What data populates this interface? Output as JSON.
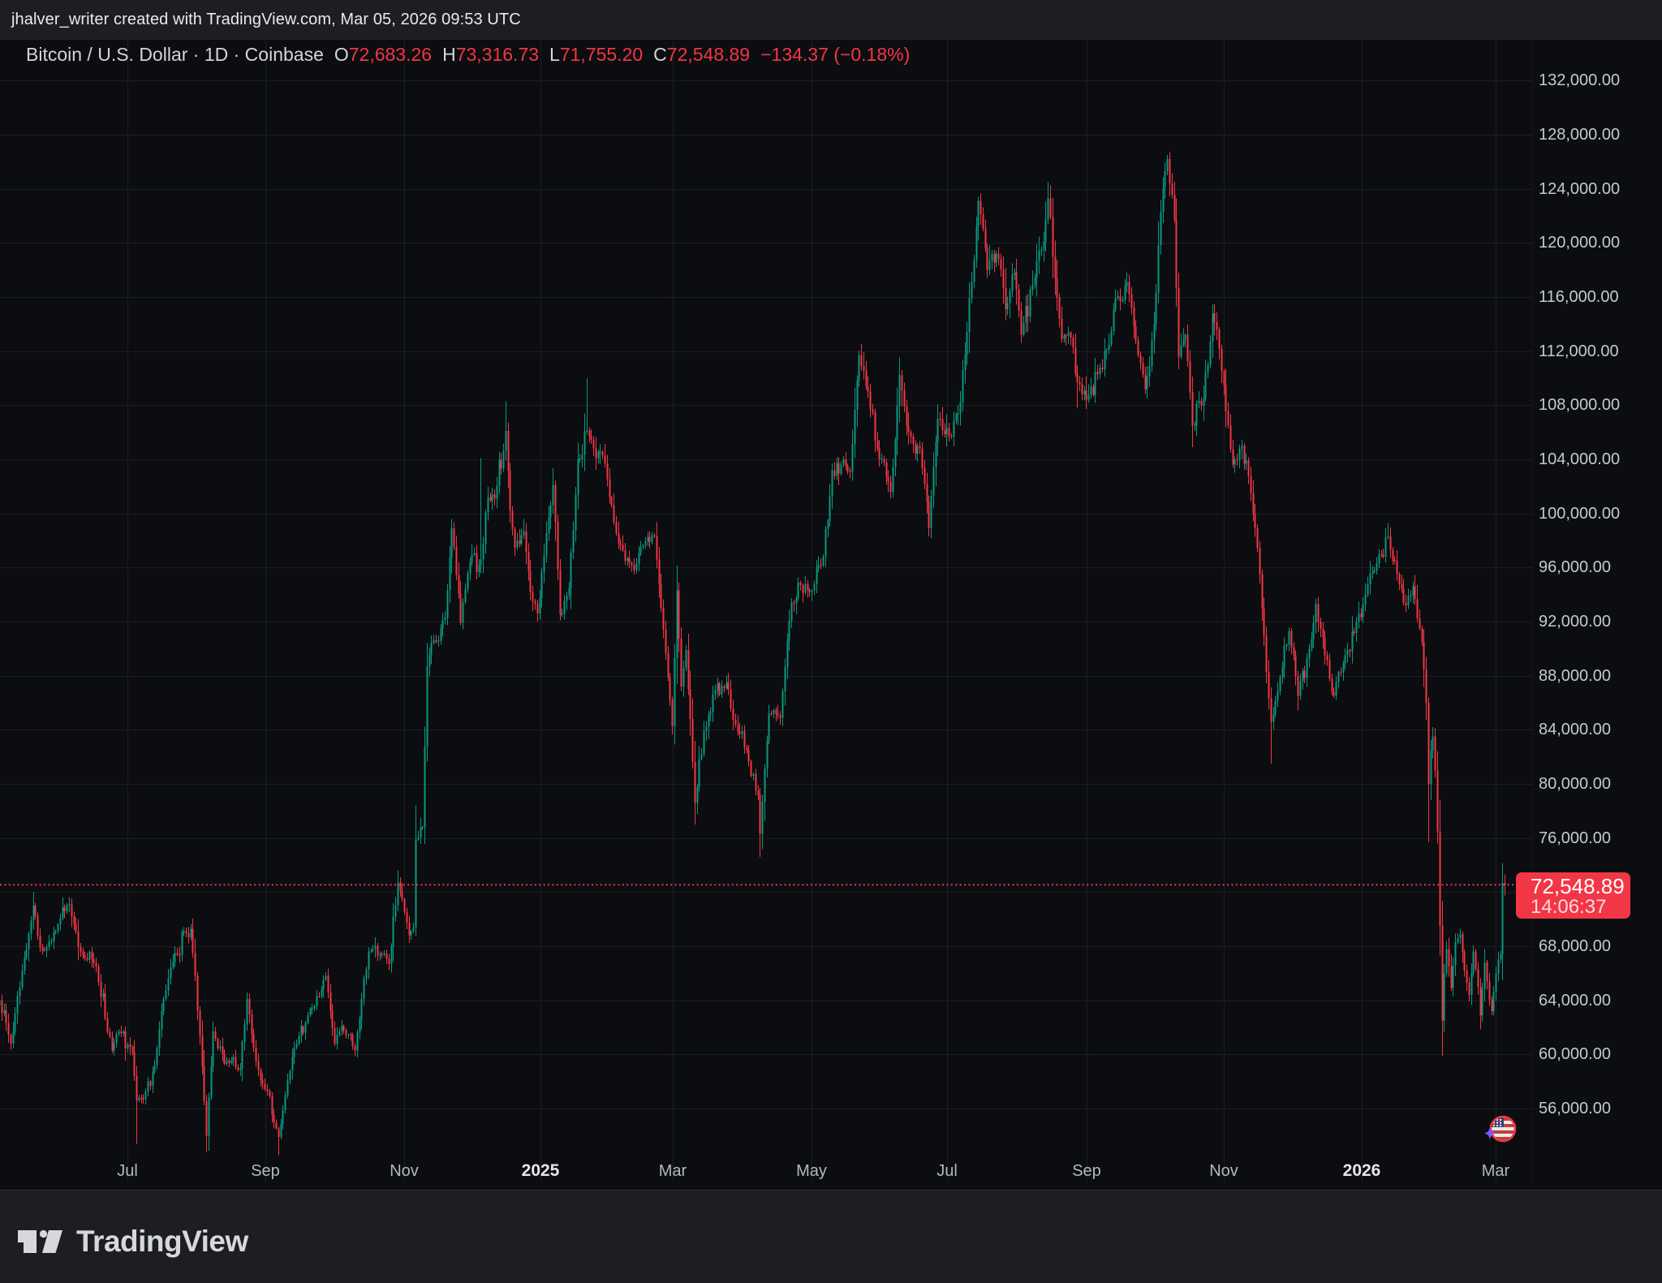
{
  "attribution_bar": {
    "text": "jhalver_writer created with TradingView.com, Mar 05, 2026 09:53 UTC"
  },
  "legend": {
    "title": "Bitcoin / U.S. Dollar · 1D · Coinbase",
    "o_label": "O",
    "o": "72,683.26",
    "h_label": "H",
    "h": "73,316.73",
    "l_label": "L",
    "l": "71,755.20",
    "c_label": "C",
    "c": "72,548.89",
    "change": "−134.37 (−0.18%)"
  },
  "price_tag": {
    "price": "72,548.89",
    "countdown": "14:06:37",
    "value": 72548.89
  },
  "logo": {
    "text": "TradingView"
  },
  "colors": {
    "up": "#089981",
    "down": "#f23645",
    "accent": "#f23645",
    "bg": "#0c0d10",
    "panel": "#1d1e21",
    "grid": "#1b1e24",
    "axis_text": "#c5c9d0",
    "title_text": "#d3d5d9"
  },
  "price_scale": {
    "labels": [
      {
        "text": "132,000.00",
        "value": 132000
      },
      {
        "text": "128,000.00",
        "value": 128000
      },
      {
        "text": "124,000.00",
        "value": 124000
      },
      {
        "text": "120,000.00",
        "value": 120000
      },
      {
        "text": "116,000.00",
        "value": 116000
      },
      {
        "text": "112,000.00",
        "value": 112000
      },
      {
        "text": "108,000.00",
        "value": 108000
      },
      {
        "text": "104,000.00",
        "value": 104000
      },
      {
        "text": "100,000.00",
        "value": 100000
      },
      {
        "text": "96,000.00",
        "value": 96000
      },
      {
        "text": "92,000.00",
        "value": 92000
      },
      {
        "text": "88,000.00",
        "value": 88000
      },
      {
        "text": "84,000.00",
        "value": 84000
      },
      {
        "text": "80,000.00",
        "value": 80000
      },
      {
        "text": "76,000.00",
        "value": 76000
      },
      {
        "text": "68,000.00",
        "value": 68000
      },
      {
        "text": "64,000.00",
        "value": 64000
      },
      {
        "text": "60,000.00",
        "value": 60000
      },
      {
        "text": "56,000.00",
        "value": 56000
      }
    ]
  },
  "time_scale": {
    "labels": [
      {
        "text": "Jul",
        "bold": false
      },
      {
        "text": "Sep",
        "bold": false
      },
      {
        "text": "Nov",
        "bold": false
      },
      {
        "text": "2025",
        "bold": true
      },
      {
        "text": "Mar",
        "bold": false
      },
      {
        "text": "May",
        "bold": false
      },
      {
        "text": "Jul",
        "bold": false
      },
      {
        "text": "Sep",
        "bold": false
      },
      {
        "text": "Nov",
        "bold": false
      },
      {
        "text": "2026",
        "bold": true
      },
      {
        "text": "Mar",
        "bold": false
      }
    ]
  },
  "chart_data": {
    "type": "candlestick",
    "symbol": "Bitcoin / U.S. Dollar",
    "interval": "1D",
    "exchange": "Coinbase",
    "start_date": "2024-05-05",
    "end_date": "2026-03-05",
    "candle_count": 670,
    "y_axis": {
      "min": 56000,
      "max": 132000,
      "step": 4000
    },
    "grid": true,
    "last_price_line": 72548.89,
    "last_candle": {
      "open": 72683.26,
      "high": 73316.73,
      "low": 71755.2,
      "close": 72548.89
    },
    "close_anchors": [
      [
        0,
        64000
      ],
      [
        5,
        60800
      ],
      [
        10,
        66200
      ],
      [
        15,
        71000
      ],
      [
        18,
        67900
      ],
      [
        23,
        68400
      ],
      [
        31,
        71100
      ],
      [
        37,
        67300
      ],
      [
        43,
        66500
      ],
      [
        50,
        60300
      ],
      [
        53,
        61700
      ],
      [
        59,
        60200
      ],
      [
        61,
        56600
      ],
      [
        64,
        56700
      ],
      [
        69,
        59200
      ],
      [
        73,
        64100
      ],
      [
        78,
        67500
      ],
      [
        85,
        69300
      ],
      [
        89,
        61400
      ],
      [
        92,
        54000
      ],
      [
        95,
        61700
      ],
      [
        100,
        59300
      ],
      [
        107,
        59000
      ],
      [
        110,
        64100
      ],
      [
        114,
        59500
      ],
      [
        119,
        57300
      ],
      [
        124,
        53900
      ],
      [
        127,
        57000
      ],
      [
        131,
        60500
      ],
      [
        137,
        62900
      ],
      [
        142,
        64300
      ],
      [
        145,
        65800
      ],
      [
        149,
        60800
      ],
      [
        152,
        62100
      ],
      [
        158,
        60300
      ],
      [
        164,
        67600
      ],
      [
        169,
        67400
      ],
      [
        173,
        66700
      ],
      [
        177,
        72700
      ],
      [
        182,
        68800
      ],
      [
        184,
        69400
      ],
      [
        185,
        75900
      ],
      [
        188,
        76800
      ],
      [
        190,
        88700
      ],
      [
        192,
        90400
      ],
      [
        195,
        90600
      ],
      [
        198,
        92300
      ],
      [
        201,
        98900
      ],
      [
        205,
        91900
      ],
      [
        209,
        96400
      ],
      [
        214,
        96600
      ],
      [
        217,
        101200
      ],
      [
        220,
        101100
      ],
      [
        225,
        106100
      ],
      [
        227,
        100200
      ],
      [
        229,
        97500
      ],
      [
        233,
        98700
      ],
      [
        236,
        94200
      ],
      [
        239,
        92600
      ],
      [
        242,
        96900
      ],
      [
        246,
        102100
      ],
      [
        249,
        92500
      ],
      [
        253,
        94500
      ],
      [
        257,
        104000
      ],
      [
        261,
        106100
      ],
      [
        264,
        104800
      ],
      [
        269,
        103700
      ],
      [
        272,
        100600
      ],
      [
        275,
        97800
      ],
      [
        278,
        96500
      ],
      [
        282,
        95800
      ],
      [
        285,
        97500
      ],
      [
        291,
        98300
      ],
      [
        295,
        91400
      ],
      [
        299,
        84300
      ],
      [
        301,
        94300
      ],
      [
        303,
        87200
      ],
      [
        305,
        89900
      ],
      [
        309,
        78600
      ],
      [
        313,
        83900
      ],
      [
        318,
        86900
      ],
      [
        323,
        87500
      ],
      [
        327,
        84400
      ],
      [
        332,
        82500
      ],
      [
        337,
        79200
      ],
      [
        338,
        76300
      ],
      [
        342,
        85200
      ],
      [
        347,
        84900
      ],
      [
        352,
        93400
      ],
      [
        356,
        94700
      ],
      [
        360,
        94200
      ],
      [
        366,
        96800
      ],
      [
        370,
        103200
      ],
      [
        374,
        103600
      ],
      [
        378,
        103100
      ],
      [
        382,
        111700
      ],
      [
        386,
        109000
      ],
      [
        391,
        104000
      ],
      [
        396,
        101600
      ],
      [
        400,
        110200
      ],
      [
        404,
        106000
      ],
      [
        409,
        104800
      ],
      [
        413,
        98900
      ],
      [
        417,
        107000
      ],
      [
        422,
        105700
      ],
      [
        427,
        108200
      ],
      [
        431,
        115900
      ],
      [
        435,
        123100
      ],
      [
        439,
        118000
      ],
      [
        444,
        118800
      ],
      [
        447,
        115100
      ],
      [
        451,
        117800
      ],
      [
        454,
        113200
      ],
      [
        459,
        116900
      ],
      [
        464,
        120100
      ],
      [
        466,
        123300
      ],
      [
        469,
        117400
      ],
      [
        472,
        112900
      ],
      [
        476,
        113000
      ],
      [
        479,
        109700
      ],
      [
        483,
        108400
      ],
      [
        488,
        110300
      ],
      [
        492,
        112100
      ],
      [
        496,
        115900
      ],
      [
        501,
        117100
      ],
      [
        505,
        112800
      ],
      [
        509,
        109200
      ],
      [
        513,
        114000
      ],
      [
        516,
        122300
      ],
      [
        519,
        126200
      ],
      [
        522,
        121700
      ],
      [
        524,
        111600
      ],
      [
        527,
        113200
      ],
      [
        530,
        106500
      ],
      [
        535,
        108500
      ],
      [
        539,
        114800
      ],
      [
        544,
        109500
      ],
      [
        548,
        103600
      ],
      [
        552,
        105000
      ],
      [
        556,
        101500
      ],
      [
        560,
        95500
      ],
      [
        565,
        84600
      ],
      [
        569,
        87900
      ],
      [
        573,
        91300
      ],
      [
        577,
        86500
      ],
      [
        582,
        90000
      ],
      [
        585,
        93300
      ],
      [
        589,
        89500
      ],
      [
        593,
        86500
      ],
      [
        598,
        89500
      ],
      [
        603,
        92000
      ],
      [
        607,
        94000
      ],
      [
        612,
        96300
      ],
      [
        617,
        98300
      ],
      [
        621,
        95500
      ],
      [
        625,
        93200
      ],
      [
        628,
        94600
      ],
      [
        632,
        90500
      ],
      [
        633,
        88500
      ],
      [
        634,
        86000
      ],
      [
        635,
        80000
      ],
      [
        636,
        82500
      ],
      [
        637,
        83500
      ],
      [
        638,
        81000
      ],
      [
        639,
        76500
      ],
      [
        640,
        69500
      ],
      [
        641,
        62500
      ],
      [
        642,
        66000
      ],
      [
        643,
        67800
      ],
      [
        644,
        66500
      ],
      [
        645,
        64900
      ],
      [
        647,
        68300
      ],
      [
        649,
        68900
      ],
      [
        651,
        66200
      ],
      [
        653,
        64400
      ],
      [
        655,
        67600
      ],
      [
        657,
        65000
      ],
      [
        658,
        62900
      ],
      [
        660,
        66800
      ],
      [
        662,
        64000
      ],
      [
        663,
        63200
      ],
      [
        665,
        66000
      ],
      [
        666,
        67000
      ],
      [
        667,
        67400
      ],
      [
        668,
        72680
      ],
      [
        669,
        72548.89
      ]
    ],
    "wick_overrides": [
      [
        15,
        "h",
        72000
      ],
      [
        61,
        "l",
        53400
      ],
      [
        92,
        "l",
        52800
      ],
      [
        124,
        "l",
        52550
      ],
      [
        177,
        "h",
        73600
      ],
      [
        201,
        "h",
        99600
      ],
      [
        214,
        "h",
        104100
      ],
      [
        225,
        "h",
        108300
      ],
      [
        261,
        "h",
        110000
      ],
      [
        309,
        "l",
        77000
      ],
      [
        338,
        "l",
        74600
      ],
      [
        382,
        "h",
        112050
      ],
      [
        413,
        "l",
        98300
      ],
      [
        435,
        "h",
        123400
      ],
      [
        466,
        "h",
        124500
      ],
      [
        479,
        "l",
        107800
      ],
      [
        519,
        "h",
        126500
      ],
      [
        530,
        "l",
        104900
      ],
      [
        565,
        "l",
        81500
      ],
      [
        617,
        "h",
        99300
      ],
      [
        635,
        "l",
        75700
      ],
      [
        641,
        "l",
        59900
      ],
      [
        668,
        "h",
        74150
      ]
    ],
    "seed": 7
  }
}
